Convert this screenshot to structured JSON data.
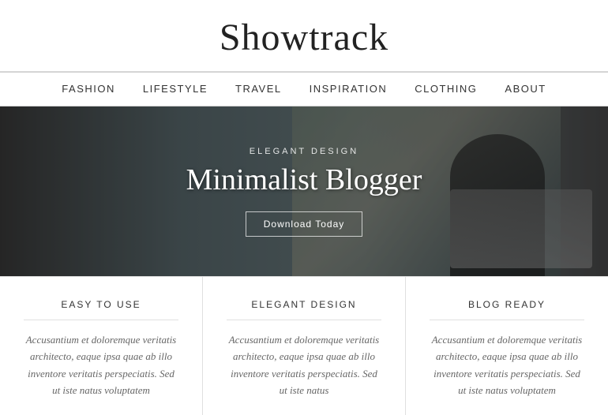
{
  "header": {
    "logo": "Showtrack"
  },
  "nav": {
    "items": [
      {
        "label": "FASHION",
        "id": "fashion"
      },
      {
        "label": "LIFESTYLE",
        "id": "lifestyle"
      },
      {
        "label": "TRAVEL",
        "id": "travel"
      },
      {
        "label": "INSPIRATION",
        "id": "inspiration"
      },
      {
        "label": "CLOTHING",
        "id": "clothing"
      },
      {
        "label": "ABOUT",
        "id": "about"
      }
    ]
  },
  "hero": {
    "subtitle": "ELEGANT DESIGN",
    "title": "Minimalist Blogger",
    "button_label": "Download Today"
  },
  "features": [
    {
      "id": "easy-to-use",
      "title": "EASY TO USE",
      "text": "Accusantium et doloremque veritatis architecto, eaque ipsa quae ab illo inventore veritatis perspeciatis. Sed ut iste natus voluptatem"
    },
    {
      "id": "elegant-design",
      "title": "ELEGANT DESIGN",
      "text": "Accusantium et doloremque veritatis architecto, eaque ipsa quae ab illo inventore veritatis perspeciatis. Sed ut iste natus"
    },
    {
      "id": "blog-ready",
      "title": "BLOG READY",
      "text": "Accusantium et doloremque veritatis architecto, eaque ipsa quae ab illo inventore veritatis perspeciatis. Sed ut iste natus voluptatem"
    }
  ]
}
